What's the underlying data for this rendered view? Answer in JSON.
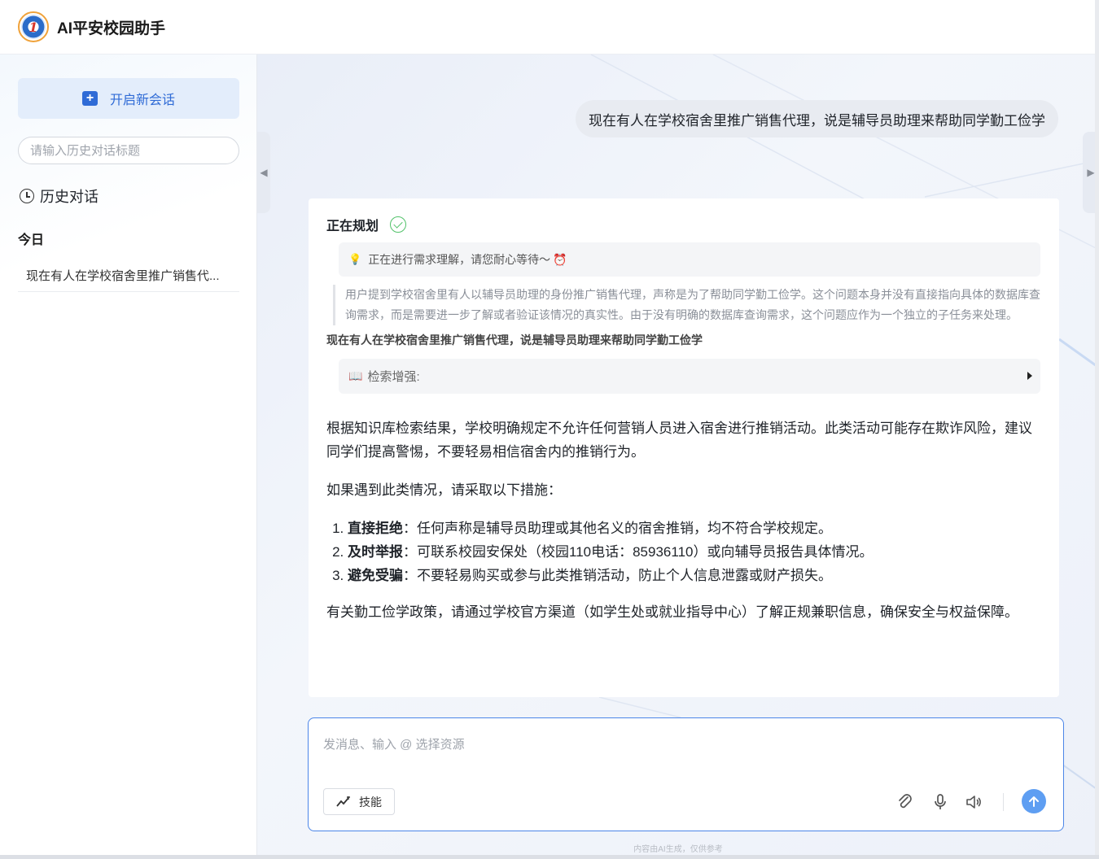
{
  "app": {
    "title": "AI平安校园助手",
    "logo_letter": "1"
  },
  "sidebar": {
    "new_chat_label": "开启新会话",
    "search_placeholder": "请输入历史对话标题",
    "history_title": "历史对话",
    "today_label": "今日",
    "items": [
      {
        "label": "现在有人在学校宿舍里推广销售代..."
      }
    ]
  },
  "chat": {
    "user_message": "现在有人在学校宿舍里推广销售代理，说是辅导员助理来帮助同学勤工俭学",
    "planning_title": "正在规划",
    "thinking_status": "正在进行需求理解，请您耐心等待～",
    "thought_text": "用户提到学校宿舍里有人以辅导员助理的身份推广销售代理，声称是为了帮助同学勤工俭学。这个问题本身并没有直接指向具体的数据库查询需求，而是需要进一步了解或者验证该情况的真实性。由于没有明确的数据库查询需求，这个问题应作为一个独立的子任务来处理。",
    "query_echo": "现在有人在学校宿舍里推广销售代理，说是辅导员助理来帮助同学勤工俭学",
    "retrieval_label": "检索增强:",
    "answer": {
      "para1": "根据知识库检索结果，学校明确规定不允许任何营销人员进入宿舍进行推销活动。此类活动可能存在欺诈风险，建议同学们提高警惕，不要轻易相信宿舍内的推销行为。",
      "para2": "如果遇到此类情况，请采取以下措施：",
      "steps": [
        {
          "title": "直接拒绝",
          "text": "：任何声称是辅导员助理或其他名义的宿舍推销，均不符合学校规定。"
        },
        {
          "title": "及时举报",
          "text": "：可联系校园安保处（校园110电话：85936110）或向辅导员报告具体情况。"
        },
        {
          "title": "避免受骗",
          "text": "：不要轻易购买或参与此类推销活动，防止个人信息泄露或财产损失。"
        }
      ],
      "para3": "有关勤工俭学政策，请通过学校官方渠道（如学生处或就业指导中心）了解正规兼职信息，确保安全与权益保障。"
    }
  },
  "composer": {
    "placeholder": "发消息、输入 @ 选择资源",
    "skill_label": "技能",
    "disclaimer": "内容由AI生成，仅供参考"
  },
  "colors": {
    "accent": "#2f6bd6",
    "send": "#5e9ef2",
    "success": "#52c26a"
  },
  "icons": [
    "plus-icon",
    "clock-icon",
    "check-icon",
    "bulb-icon",
    "alarm-icon",
    "book-icon",
    "paperclip-icon",
    "microphone-icon",
    "speaker-icon",
    "arrow-up-icon",
    "skill-icon"
  ]
}
